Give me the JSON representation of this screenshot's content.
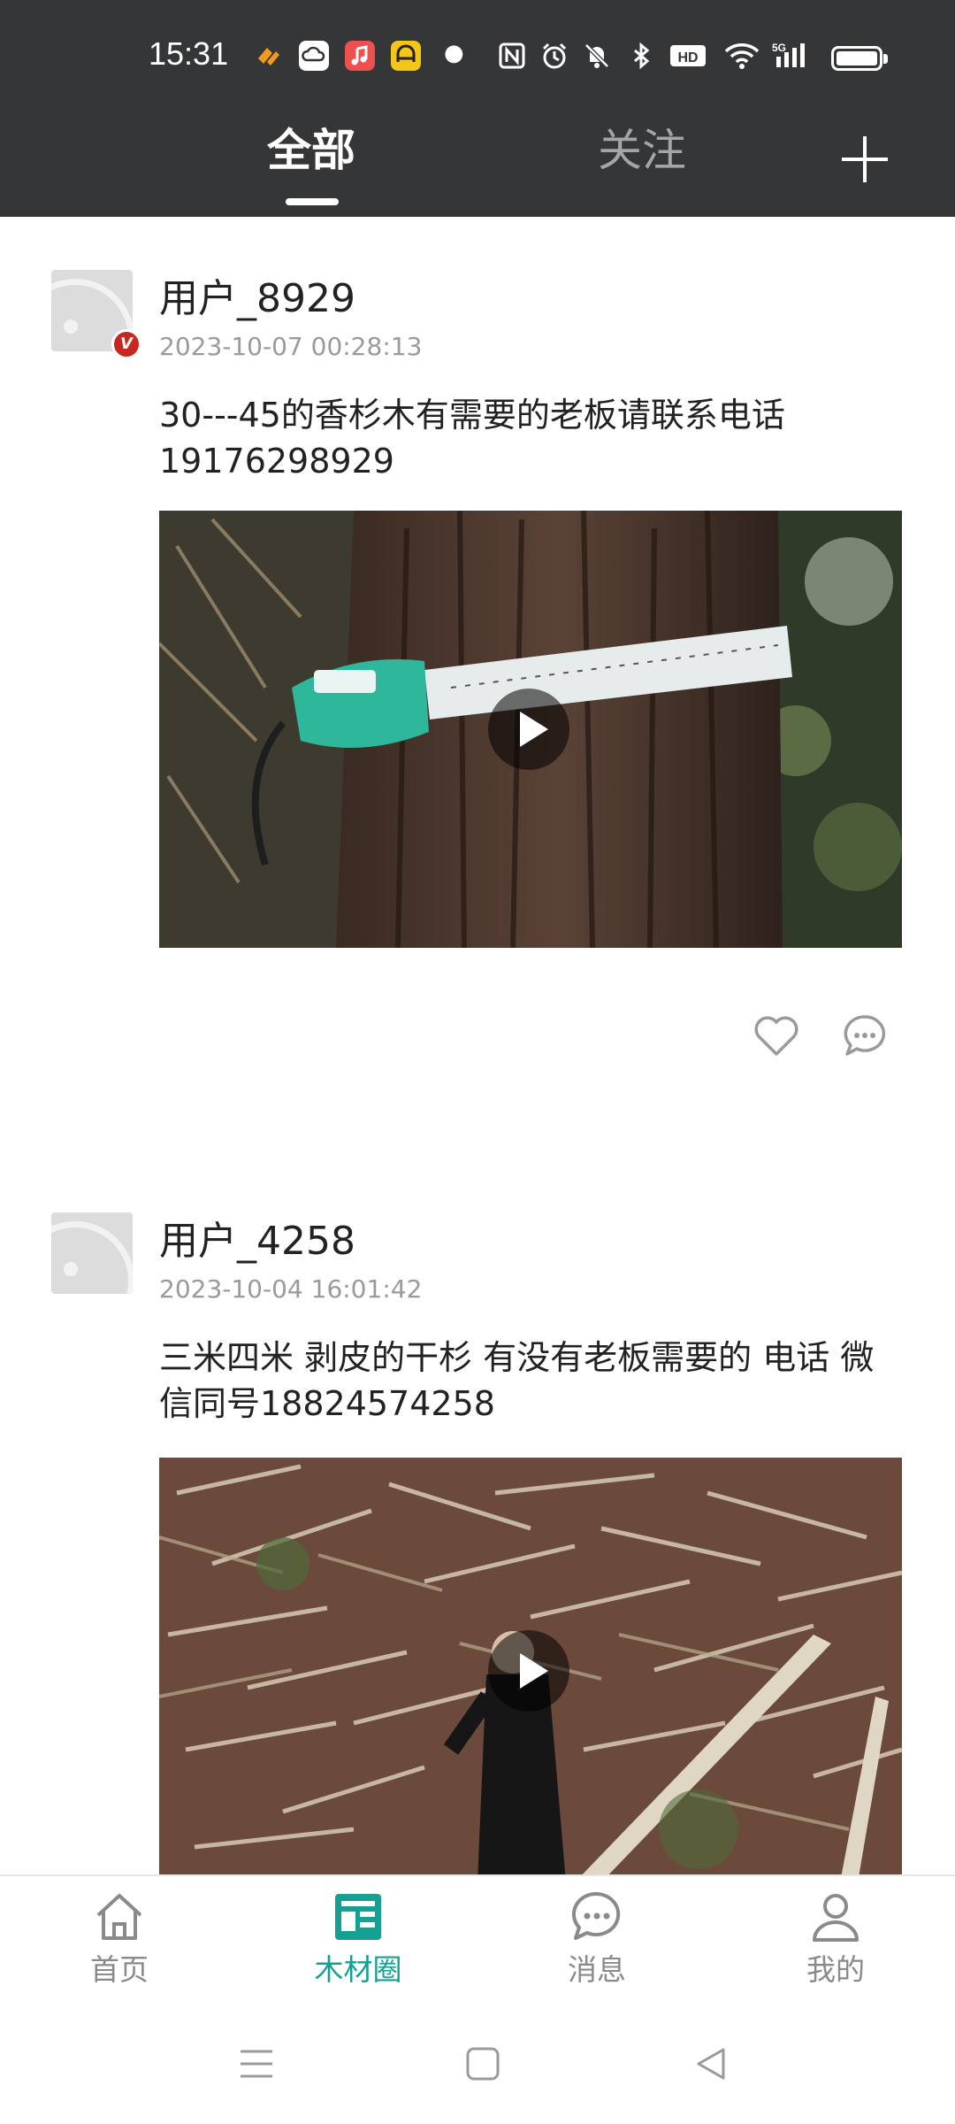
{
  "status_bar": {
    "time": "15:31",
    "icons": [
      "app-icon-orange",
      "cloud-icon",
      "music-icon",
      "app-icon-yellow",
      "dot-icon",
      "nfc-icon",
      "alarm-icon",
      "mute-icon",
      "bluetooth-icon",
      "hd-icon",
      "wifi-icon",
      "5g-signal-icon",
      "battery-icon"
    ],
    "network_label": "5G",
    "hd_label": "HD"
  },
  "header": {
    "tabs": [
      {
        "label": "全部",
        "active": true
      },
      {
        "label": "关注",
        "active": false
      }
    ],
    "add_icon": "plus-icon"
  },
  "posts": [
    {
      "username": "用户_8929",
      "verified": true,
      "verified_badge": "V",
      "time": "2023-10-07 00:28:13",
      "text": "30---45的香杉木有需要的老板请联系电话19176298929",
      "media_type": "video"
    },
    {
      "username": "用户_4258",
      "verified": false,
      "time": "2023-10-04 16:01:42",
      "text": "三米四米 剥皮的干杉 有没有老板需要的   电话 微信同号18824574258",
      "media_type": "video"
    }
  ],
  "post_actions": {
    "like_icon": "heart-icon",
    "comment_icon": "comment-icon"
  },
  "bottom_nav": {
    "items": [
      {
        "label": "首页",
        "icon": "home-icon",
        "active": false
      },
      {
        "label": "木材圈",
        "icon": "feed-icon",
        "active": true
      },
      {
        "label": "消息",
        "icon": "message-icon",
        "active": false
      },
      {
        "label": "我的",
        "icon": "profile-icon",
        "active": false
      }
    ]
  },
  "colors": {
    "header_bg": "#343638",
    "accent": "#15a093",
    "inactive_nav": "#8a8a8a",
    "verified_badge": "#c8261e"
  }
}
